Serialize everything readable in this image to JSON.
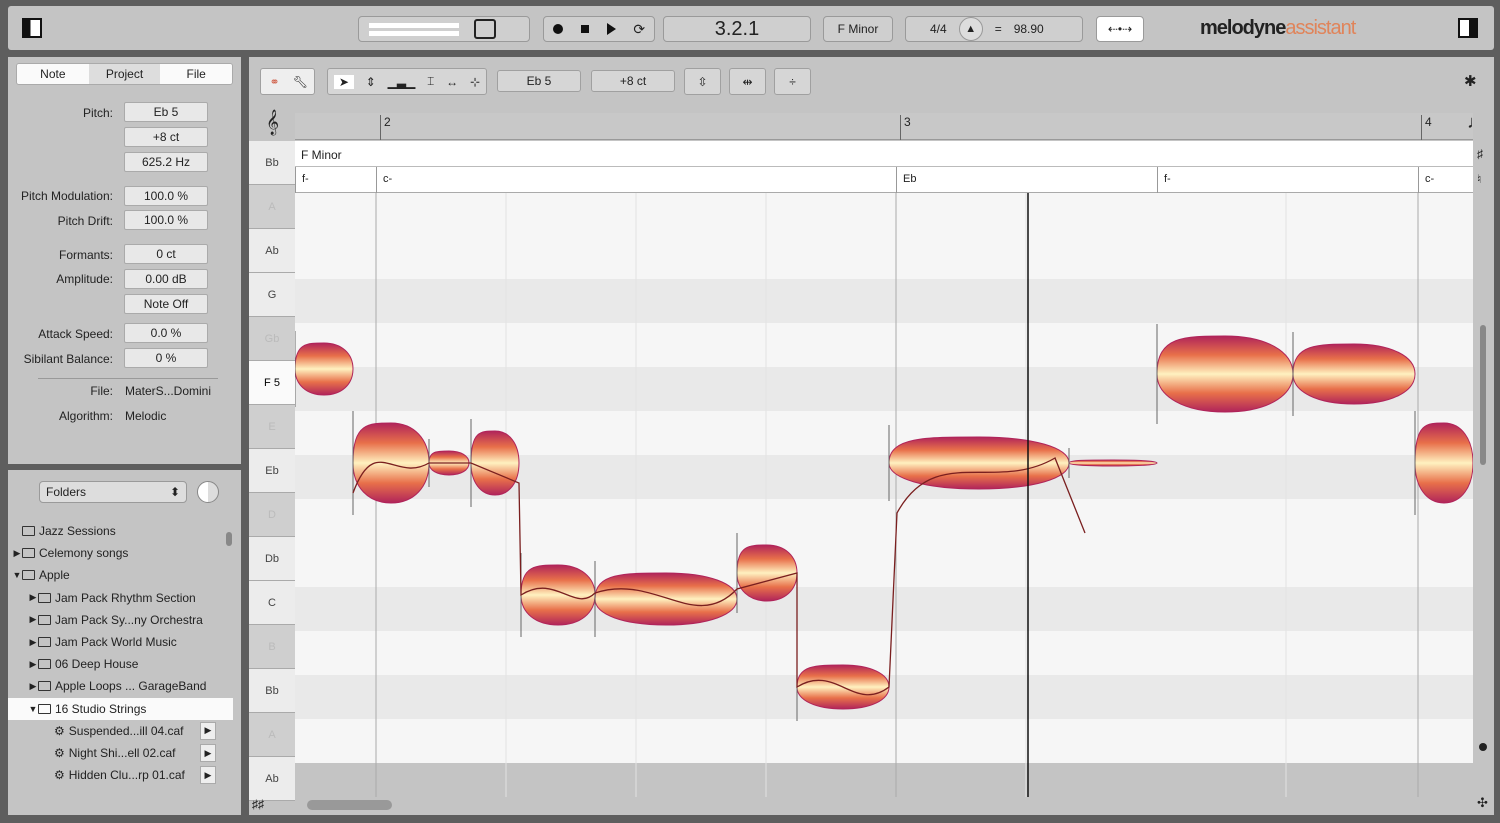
{
  "topbar": {
    "position": "3.2.1",
    "key": "F Minor",
    "time_signature": "4/4",
    "tempo_eq": "=",
    "tempo": "98.90",
    "logo_main": "melodyne",
    "logo_sub": "assistant",
    "icons": [
      "sidebar-toggle-icon",
      "record-icon",
      "stop-icon",
      "play-icon",
      "loop-icon",
      "metronome-icon",
      "tempo-detect-icon",
      "panel-toggle-icon"
    ]
  },
  "inspector": {
    "tabs": [
      "Note",
      "Project",
      "File"
    ],
    "active_tab": "Note",
    "pitch_label": "Pitch:",
    "pitch": "Eb 5",
    "pitch_cents": "+8 ct",
    "pitch_hz": "625.2 Hz",
    "pitch_mod_label": "Pitch Modulation:",
    "pitch_mod": "100.0 %",
    "pitch_drift_label": "Pitch Drift:",
    "pitch_drift": "100.0 %",
    "formants_label": "Formants:",
    "formants": "0 ct",
    "amplitude_label": "Amplitude:",
    "amplitude": "0.00 dB",
    "note_off": "Note Off",
    "attack_label": "Attack Speed:",
    "attack": "0.0 %",
    "sibilant_label": "Sibilant Balance:",
    "sibilant": "0 %",
    "file_label": "File:",
    "file": "MaterS...Domini",
    "algorithm_label": "Algorithm:",
    "algorithm": "Melodic"
  },
  "browser": {
    "selector": "Folders",
    "items": [
      {
        "label": "Jazz Sessions",
        "indent": 0,
        "arrow": "",
        "type": "folder"
      },
      {
        "label": "Celemony songs",
        "indent": 0,
        "arrow": "▶",
        "type": "folder"
      },
      {
        "label": "Apple",
        "indent": 0,
        "arrow": "▼",
        "type": "folder"
      },
      {
        "label": "Jam Pack Rhythm Section",
        "indent": 1,
        "arrow": "▶",
        "type": "folder"
      },
      {
        "label": "Jam Pack Sy...ny Orchestra",
        "indent": 1,
        "arrow": "▶",
        "type": "folder"
      },
      {
        "label": "Jam Pack World Music",
        "indent": 1,
        "arrow": "▶",
        "type": "folder"
      },
      {
        "label": "06 Deep House",
        "indent": 1,
        "arrow": "▶",
        "type": "folder"
      },
      {
        "label": "Apple Loops ... GarageBand",
        "indent": 1,
        "arrow": "▶",
        "type": "folder"
      },
      {
        "label": "16 Studio Strings",
        "indent": 1,
        "arrow": "▼",
        "type": "folder",
        "selected": true
      },
      {
        "label": "Suspended...ill 04.caf",
        "indent": 2,
        "arrow": "",
        "type": "file"
      },
      {
        "label": "Night Shi...ell 02.caf",
        "indent": 2,
        "arrow": "",
        "type": "file"
      },
      {
        "label": "Hidden Clu...rp 01.caf",
        "indent": 2,
        "arrow": "",
        "type": "file"
      }
    ]
  },
  "editor": {
    "toolbar": {
      "pitch": "Eb 5",
      "cents": "+8 ct"
    },
    "ruler": [
      "2",
      "3",
      "4"
    ],
    "scale": "F Minor",
    "chords": [
      "f-",
      "c-",
      "Eb",
      "f-",
      "c-"
    ],
    "pitch_rows": [
      {
        "n": "Bb",
        "in": true
      },
      {
        "n": "A",
        "in": false
      },
      {
        "n": "Ab",
        "in": true
      },
      {
        "n": "G",
        "in": true
      },
      {
        "n": "Gb",
        "in": false
      },
      {
        "n": "F 5",
        "in": true
      },
      {
        "n": "E",
        "in": false
      },
      {
        "n": "Eb",
        "in": true
      },
      {
        "n": "D",
        "in": false
      },
      {
        "n": "Db",
        "in": true
      },
      {
        "n": "C",
        "in": true
      },
      {
        "n": "B",
        "in": false
      },
      {
        "n": "Bb",
        "in": true
      },
      {
        "n": "A",
        "in": false
      },
      {
        "n": "Ab",
        "in": true
      }
    ]
  },
  "colors": {
    "blob_dark": "#b0245a",
    "blob_mid": "#e8704a",
    "blob_light": "#fff1c0",
    "logo_accent": "#e0845a"
  }
}
